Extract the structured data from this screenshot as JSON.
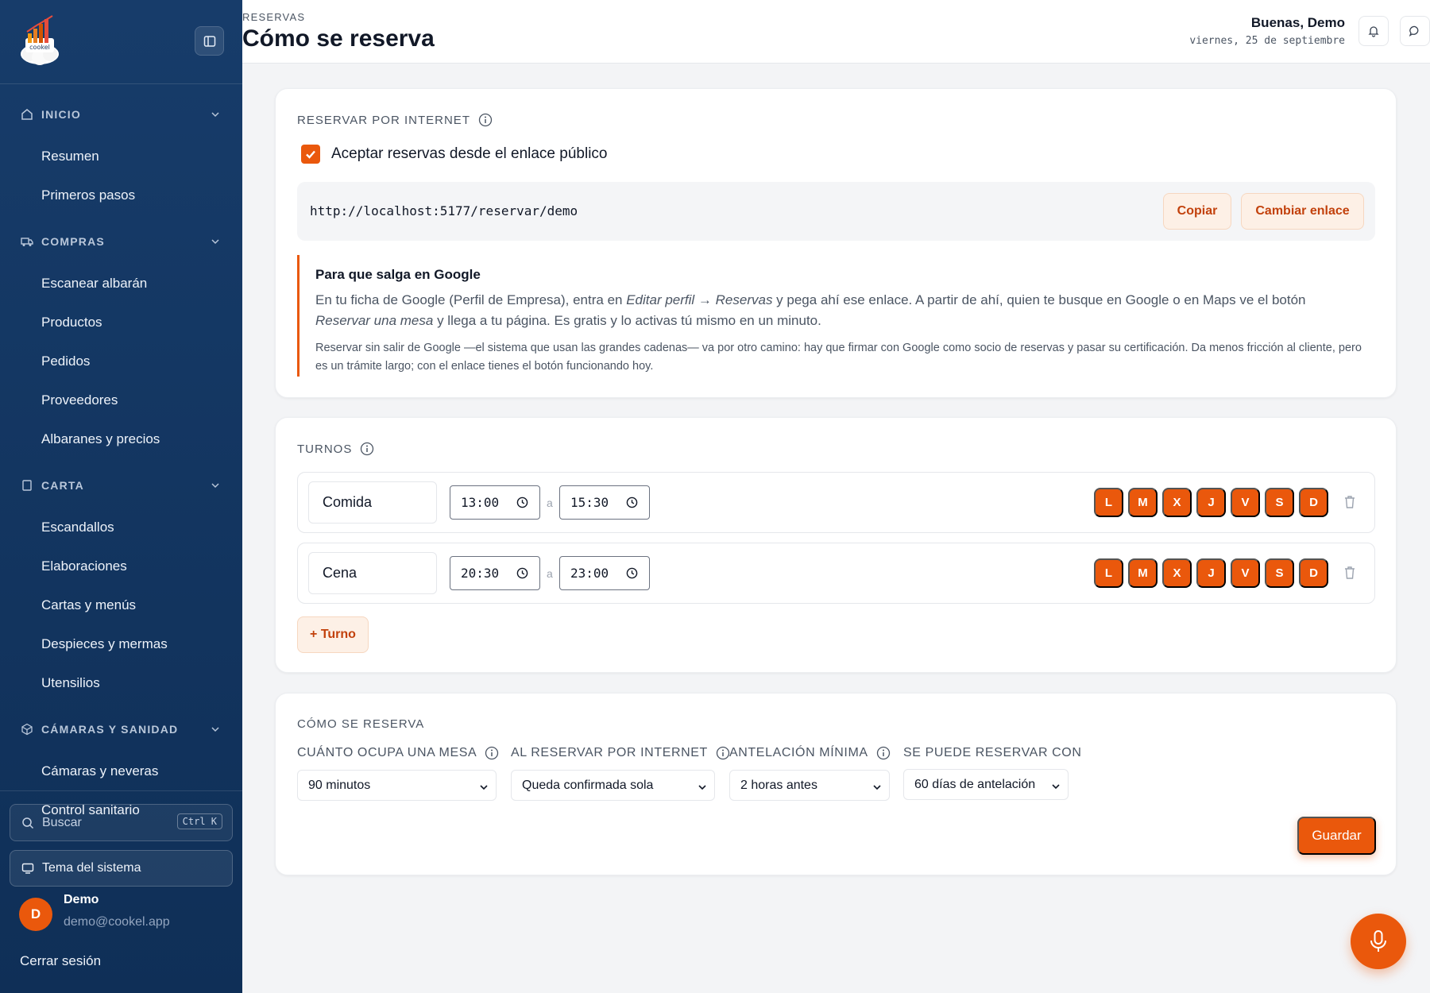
{
  "sidebar": {
    "logo_text": "cookel",
    "sections": [
      {
        "label": "INICIO",
        "icon": "home-icon",
        "items": [
          "Resumen",
          "Primeros pasos"
        ]
      },
      {
        "label": "COMPRAS",
        "icon": "truck-icon",
        "items": [
          "Escanear albarán",
          "Productos",
          "Pedidos",
          "Proveedores",
          "Albaranes y precios"
        ]
      },
      {
        "label": "CARTA",
        "icon": "book-icon",
        "items": [
          "Escandallos",
          "Elaboraciones",
          "Cartas y menús",
          "Despieces y mermas",
          "Utensilios"
        ]
      },
      {
        "label": "CÁMARAS Y SANIDAD",
        "icon": "box-icon",
        "items": [
          "Cámaras y neveras",
          "Control sanitario"
        ]
      }
    ],
    "search_placeholder": "Buscar",
    "search_shortcut": "Ctrl K",
    "theme_label": "Tema del sistema",
    "user": {
      "initial": "D",
      "name": "Demo",
      "email": "demo@cookel.app"
    },
    "logout_label": "Cerrar sesión"
  },
  "header": {
    "eyebrow": "RESERVAS",
    "title": "Cómo se reserva",
    "greeting": "Buenas, Demo",
    "date": "viernes, 25 de septiembre"
  },
  "online": {
    "title": "RESERVAR POR INTERNET",
    "accept_label": "Aceptar reservas desde el enlace público",
    "accept_checked": true,
    "url": "http://localhost:5177/reservar/demo",
    "copy_label": "Copiar",
    "change_label": "Cambiar enlace",
    "google": {
      "title": "Para que salga en Google",
      "text_1": "En tu ficha de Google (Perfil de Empresa), entra en ",
      "text_em1": "Editar perfil → Reservas",
      "text_2": " y pega ahí ese enlace. A partir de ahí, quien te busque en Google o en Maps ve el botón ",
      "text_em2": "Reservar una mesa",
      "text_3": " y llega a tu página. Es gratis y lo activas tú mismo en un minuto.",
      "note": "Reservar sin salir de Google —el sistema que usan las grandes cadenas— va por otro camino: hay que firmar con Google como socio de reservas y pasar su certificación. Da menos fricción al cliente, pero es un trámite largo; con el enlace tienes el botón funcionando hoy."
    }
  },
  "shifts": {
    "title": "TURNOS",
    "separator": "a",
    "rows": [
      {
        "name": "Comida",
        "start": "13:00",
        "end": "15:30"
      },
      {
        "name": "Cena",
        "start": "20:30",
        "end": "23:00"
      }
    ],
    "days": [
      "L",
      "M",
      "X",
      "J",
      "V",
      "S",
      "D"
    ],
    "add_label": "+ Turno"
  },
  "booking": {
    "title": "CÓMO SE RESERVA",
    "fields": [
      {
        "label": "CUÁNTO OCUPA UNA MESA",
        "value": "90 minutos",
        "info": true
      },
      {
        "label": "AL RESERVAR POR INTERNET",
        "value": "Queda confirmada sola",
        "info": true
      },
      {
        "label": "ANTELACIÓN MÍNIMA",
        "value": "2 horas antes",
        "info": true
      },
      {
        "label": "SE PUEDE RESERVAR CON",
        "value": "60 días de antelación",
        "info": false
      }
    ],
    "save_label": "Guardar"
  },
  "colors": {
    "accent": "#ea580c",
    "sidebar": "#123461"
  }
}
